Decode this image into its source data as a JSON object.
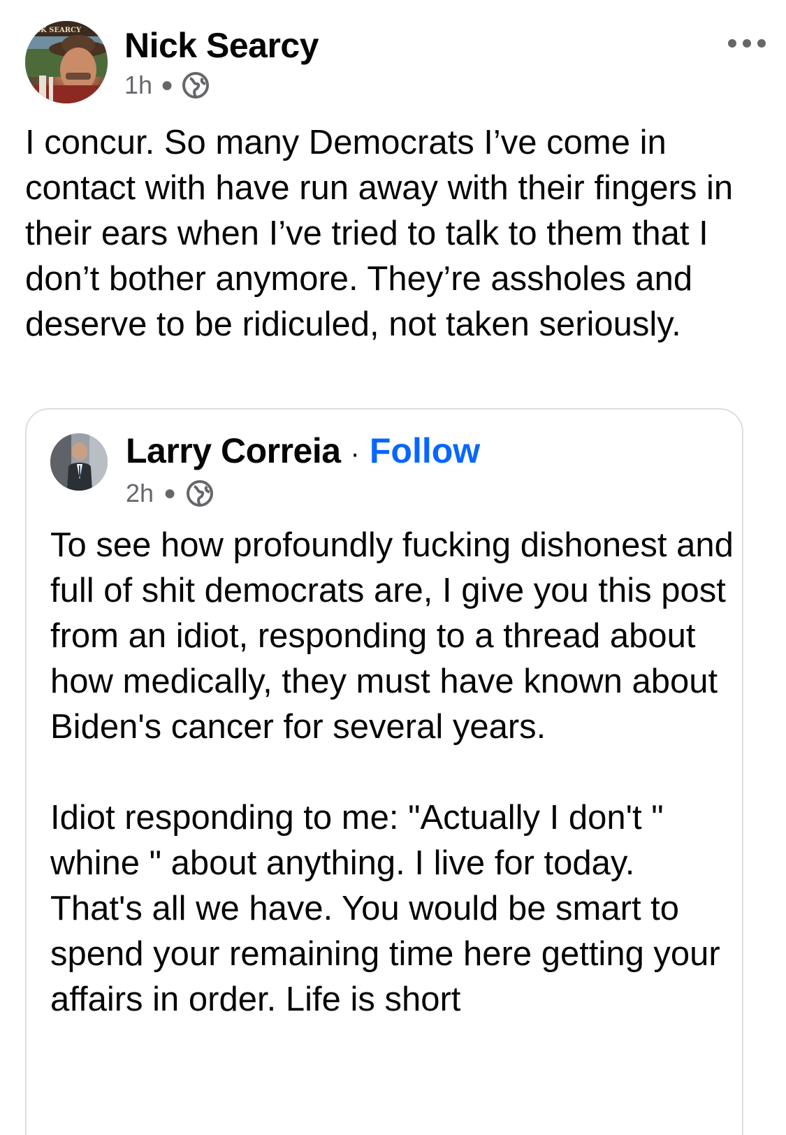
{
  "post": {
    "author": "Nick Searcy",
    "time": "1h",
    "privacy_icon": "globe-icon",
    "more_icon": "more-options-icon",
    "text": "I concur. So many Democrats I’ve come in contact with have run away with their fingers in their ears when I’ve tried to talk to them that I don’t bother anymore. They’re assholes and deserve to be ridiculed, not taken seriously."
  },
  "shared_post": {
    "author": "Larry Correia",
    "separator": "·",
    "follow_label": "Follow",
    "time": "2h",
    "privacy_icon": "globe-icon",
    "paragraphs": [
      "To see how profoundly fucking dishonest and full of shit democrats are, I give you this post from an idiot, responding to a thread about how medically, they must have known about Biden's cancer for several years.",
      "Idiot responding to me: \"Actually I don't \" whine \" about anything. I live for today. That's all we have. You would be smart to spend your remaining time here getting your affairs in order. Life is short"
    ]
  },
  "avatar_text": "CK SEARCY",
  "colors": {
    "link": "#0866ff",
    "meta": "#65676b",
    "text": "#050505",
    "border": "#dadde1"
  }
}
